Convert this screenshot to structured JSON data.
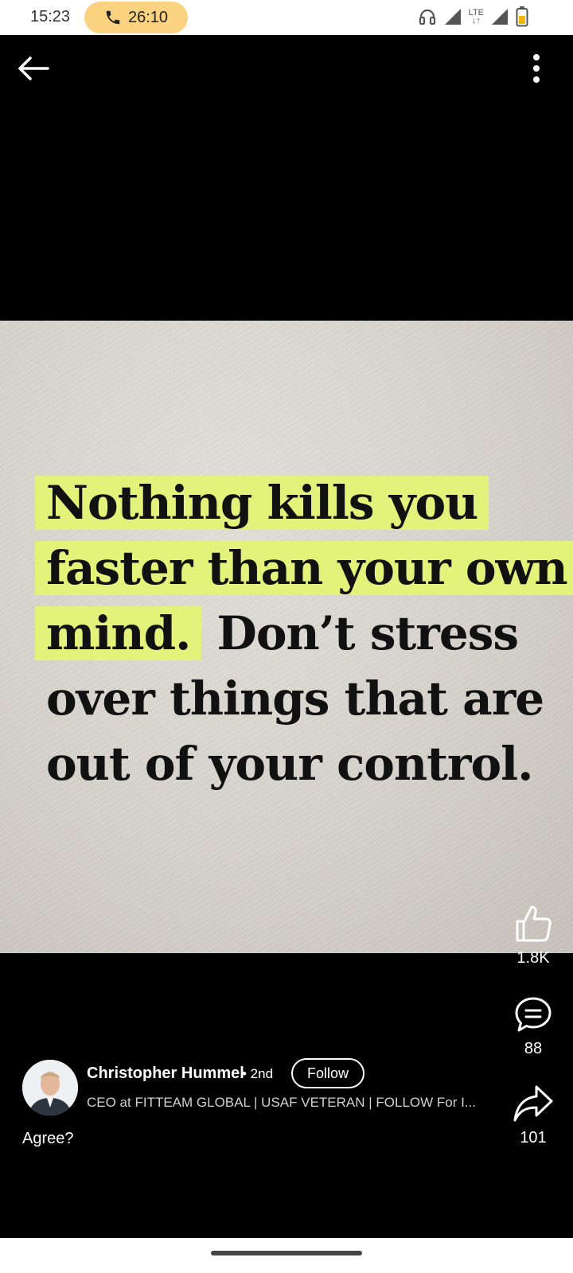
{
  "status_bar": {
    "time": "15:23",
    "call_timer": "26:10",
    "network_label": "LTE",
    "icons": [
      "headphones-icon",
      "signal-icon",
      "lte-signal-icon",
      "battery-icon"
    ],
    "battery_color": "#f4b400"
  },
  "toolbar": {
    "back_icon": "arrow-left-icon",
    "more_icon": "more-vertical-icon"
  },
  "post": {
    "quote_lines": [
      {
        "text": "Nothing kills you",
        "highlighted": true
      },
      {
        "text": "faster than your own",
        "highlighted": true
      },
      {
        "text_highlighted": "mind.",
        "text_rest": " Don’t stress"
      },
      {
        "text": "over things that are",
        "highlighted": false
      },
      {
        "text": "out of your control.",
        "highlighted": false
      }
    ],
    "highlight_color": "#e2f27a",
    "caption": "Agree?"
  },
  "actions": {
    "likes": "1.8K",
    "comments": "88",
    "shares": "101"
  },
  "author": {
    "name": "Christopher Hummel",
    "degree": "• 2nd",
    "follow_label": "Follow",
    "headline": "CEO at FITTEAM GLOBAL | USAF VETERAN | FOLLOW For I..."
  }
}
